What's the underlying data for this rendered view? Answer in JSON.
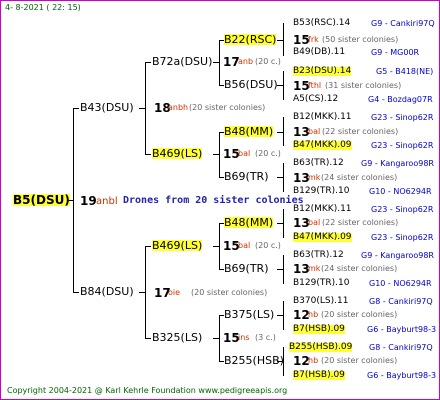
{
  "header": {
    "date": "4-  8-2021 ( 22: 15)"
  },
  "footer": {
    "copyright": "Copyright 2004-2021 @ Karl Kehrle Foundation   www.pedigreeapis.org"
  },
  "root": {
    "label": "B5(DSU)",
    "num": "19",
    "code": "anbl",
    "note": "Drones from 20 sister colonies"
  },
  "mothers": [
    {
      "label": "B43(DSU)",
      "num": "18",
      "code": "anbh",
      "note": "(20 sister colonies)"
    },
    {
      "label": "B84(DSU)",
      "num": "17",
      "code": "oie",
      "note": "(20 sister colonies)"
    }
  ],
  "grand": [
    {
      "label": "B72a(DSU)",
      "num": "17",
      "code": "anb",
      "note": "(20 c.)"
    },
    {
      "label": "B469(LS)",
      "num": "15",
      "code": "bal",
      "note": "(20 c.)"
    },
    {
      "label": "B469(LS)",
      "num": "15",
      "code": "bal",
      "note": "(20 c.)"
    },
    {
      "label": "B325(LS)",
      "num": "15",
      "code": "ins",
      "note": "(3 c.)"
    }
  ],
  "great": [
    {
      "label": "B22(RSC)",
      "num": "15",
      "code": "frk",
      "note": "(50 sister colonies)"
    },
    {
      "label": "B56(DSU)",
      "num": "15",
      "code": "fthl",
      "note": "(31 sister colonies)"
    },
    {
      "label": "B48(MM)",
      "num": "13",
      "code": "bal",
      "note": "(22 sister colonies)"
    },
    {
      "label": "B69(TR)",
      "num": "13",
      "code": "mk",
      "note": "(24 sister colonies)"
    },
    {
      "label": "B48(MM)",
      "num": "13",
      "code": "bal",
      "note": "(22 sister colonies)"
    },
    {
      "label": "B69(TR)",
      "num": "13",
      "code": "mk",
      "note": "(24 sister colonies)"
    },
    {
      "label": "B375(LS)",
      "num": "12",
      "code": "hb",
      "note": "(20 sister colonies)"
    },
    {
      "label": "B255(HSB)",
      "num": "12",
      "code": "hb",
      "note": "(20 sister colonies)"
    }
  ],
  "leaves": [
    {
      "name": "B53(RSC).14",
      "loc": "G9 - Cankiri97Q"
    },
    {
      "name": "B49(DB).11",
      "loc": "G9 - MG00R"
    },
    {
      "name": "B23(DSU).14",
      "loc": "G5 - B418(NE)"
    },
    {
      "name": "A5(CS).12",
      "loc": "G4 - Bozdag07R"
    },
    {
      "name": "B12(MKK).11",
      "loc": "G23 - Sinop62R"
    },
    {
      "name": "B47(MKK).09",
      "loc": "G23 - Sinop62R"
    },
    {
      "name": "B63(TR).12",
      "loc": "G9 - Kangaroo98R"
    },
    {
      "name": "B129(TR).10",
      "loc": "G10 - NO6294R"
    },
    {
      "name": "B12(MKK).11",
      "loc": "G23 - Sinop62R"
    },
    {
      "name": "B47(MKK).09",
      "loc": "G23 - Sinop62R"
    },
    {
      "name": "B63(TR).12",
      "loc": "G9 - Kangaroo98R"
    },
    {
      "name": "B129(TR).10",
      "loc": "G10 - NO6294R"
    },
    {
      "name": "B370(LS).11",
      "loc": "G8 - Cankiri97Q"
    },
    {
      "name": "B7(HSB).09",
      "loc": "G6 - Bayburt98-3"
    },
    {
      "name": "B255(HSB).09",
      "loc": "G8 - Cankiri97Q"
    },
    {
      "name": "B7(HSB).09",
      "loc": "G6 - Bayburt98-3"
    }
  ]
}
